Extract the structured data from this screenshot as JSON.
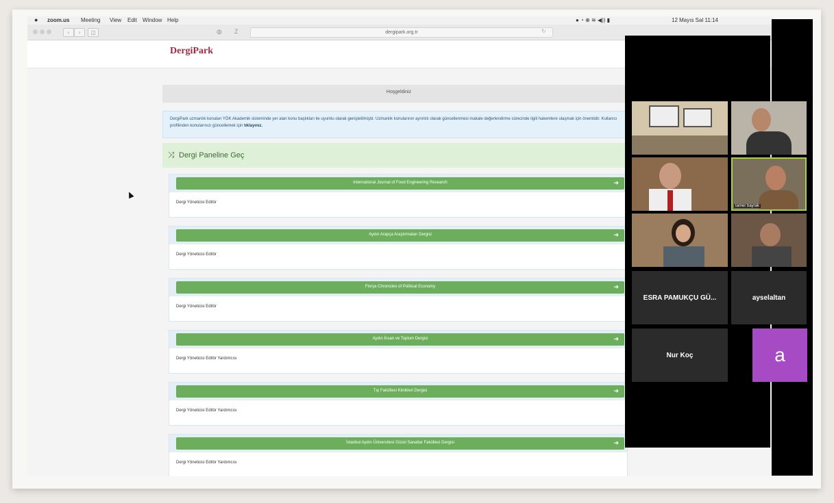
{
  "menubar": {
    "app": "zoom.us",
    "items": [
      "Meeting",
      "View",
      "Edit",
      "Window",
      "Help"
    ],
    "clock": "12 Mayıs Sal 11:14"
  },
  "browser": {
    "url": "dergipark.org.tr"
  },
  "site": {
    "logo": "DergiPark",
    "welcome_title": "Hoşgeldiniz",
    "info_text": "DergiPark uzmanlık konuları YÖK Akademik sisteminde yer alan konu başlıkları ile uyumlu olarak genişletilmiştir. Uzmanlık konularının ayrıntılı olarak güncellenmesi makale değerlendirme sürecinde ilgili hakemlere ulaşmak için önemlidir. Kullanıcı profilinden konularınızı güncellemek için",
    "info_link": "tıklayınız.",
    "panel_label": "Dergi Paneline Geç"
  },
  "journals": [
    {
      "name": "International Journal of Food Engineering Research",
      "role": "Dergi Yöneticisi Editör"
    },
    {
      "name": "Aydın Arapça Araştırmaları Dergisi",
      "role": "Dergi Yöneticisi Editör"
    },
    {
      "name": "Florya Chronicles of Political Economy",
      "role": "Dergi Yöneticisi Editör"
    },
    {
      "name": "Aydın İnsan ve Toplum Dergisi",
      "role": "Dergi Yöneticisi Editör Yardımcısı"
    },
    {
      "name": "Tıp Fakültesi Klinikleri Dergisi",
      "role": "Dergi Yöneticisi Editör Yardımcısı"
    },
    {
      "name": "İstanbul Aydın Üniversitesi Güzel Sanatlar Fakültesi Dergisi",
      "role": "Dergi Yöneticisi Editör Yardımcısı"
    }
  ],
  "zoom": {
    "tiles": [
      {
        "name": "",
        "kind": "video",
        "color": "#cdbd9f"
      },
      {
        "name": "",
        "kind": "video",
        "color": "#6e6757"
      },
      {
        "name": "",
        "kind": "video",
        "color": "#8a6848"
      },
      {
        "name": "tamer bayrak",
        "kind": "video",
        "color": "#6c6656"
      },
      {
        "name": "",
        "kind": "video",
        "color": "#98785a"
      },
      {
        "name": "",
        "kind": "video",
        "color": "#6e5a49"
      }
    ],
    "name_tiles": [
      "ESRA PAMUKÇU GÜ...",
      "ayselaltan",
      "Nur Koç"
    ],
    "avatar_letter": "a"
  }
}
